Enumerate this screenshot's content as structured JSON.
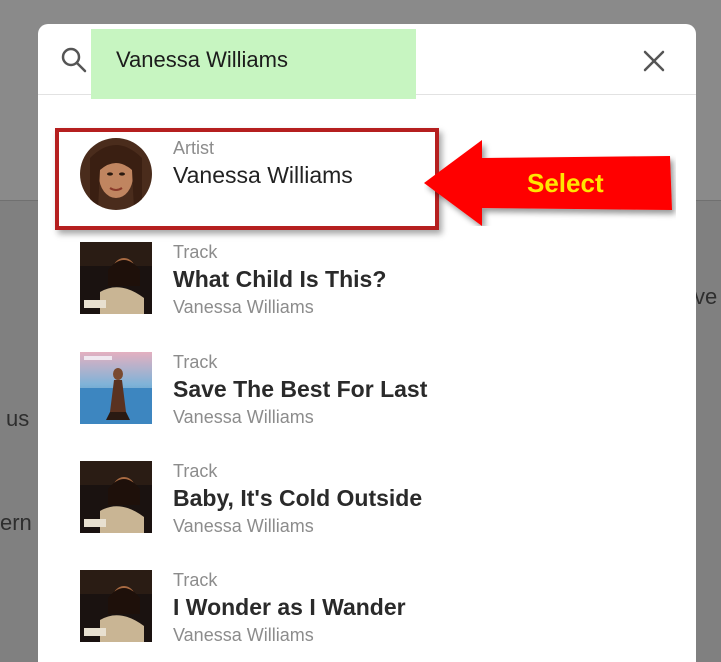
{
  "background": {
    "fragments": [
      "ve",
      "us",
      "ern"
    ]
  },
  "search": {
    "value": "Vanessa Williams",
    "icon": "search-icon",
    "close_icon": "close-icon"
  },
  "results": [
    {
      "type": "Artist",
      "title": "Vanessa Williams",
      "subtitle": "",
      "thumb": "artist-portrait"
    },
    {
      "type": "Track",
      "title": "What Child Is This?",
      "subtitle": "Vanessa Williams",
      "thumb": "album-star-bright"
    },
    {
      "type": "Track",
      "title": "Save The Best For Last",
      "subtitle": "Vanessa Williams",
      "thumb": "album-comfort-zone"
    },
    {
      "type": "Track",
      "title": "Baby, It's Cold Outside",
      "subtitle": "Vanessa Williams",
      "thumb": "album-star-bright"
    },
    {
      "type": "Track",
      "title": "I Wonder as I Wander",
      "subtitle": "Vanessa Williams",
      "thumb": "album-star-bright"
    }
  ],
  "annotation": {
    "label": "Select",
    "box_color": "#b51f1f",
    "arrow_color": "#ff0000",
    "label_color": "#ffe600"
  },
  "colors": {
    "search_highlight": "#c7f5c1",
    "overlay": "#8a8a8a"
  }
}
